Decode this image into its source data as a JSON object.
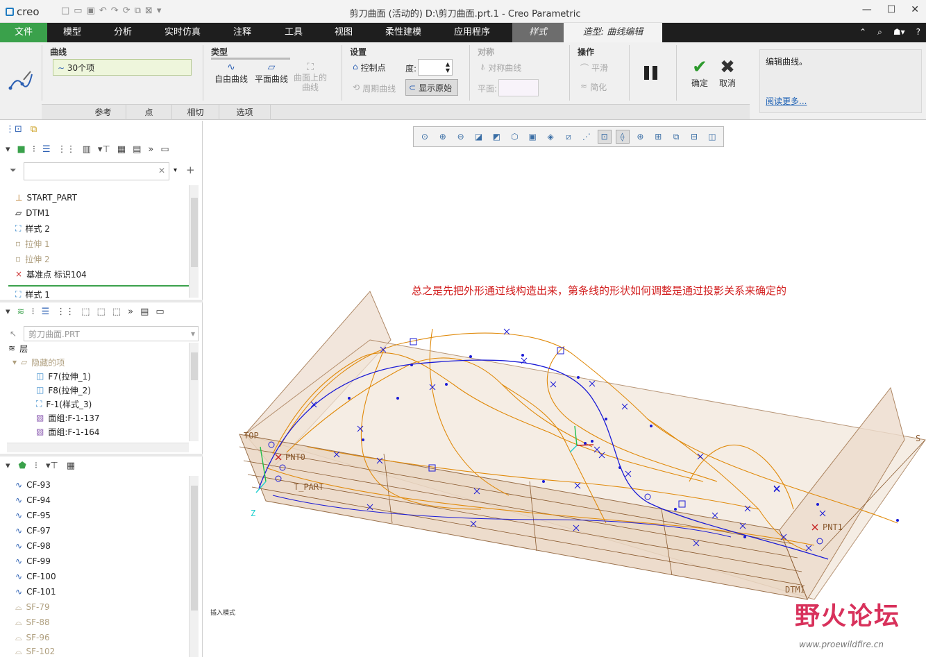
{
  "titlebar": {
    "logo": "creo",
    "title": "剪刀曲面 (活动的) D:\\剪刀曲面.prt.1 - Creo Parametric"
  },
  "menu": {
    "tabs": [
      "文件",
      "模型",
      "分析",
      "实时仿真",
      "注释",
      "工具",
      "视图",
      "柔性建模",
      "应用程序",
      "样式",
      "造型: 曲线编辑"
    ]
  },
  "ribbon": {
    "curve_group": "曲线",
    "curve_count": "30个项",
    "type_group": "类型",
    "type_free": "自由曲线",
    "type_plane": "平面曲线",
    "type_on_surface": "曲面上的曲线",
    "settings_group": "设置",
    "control_points": "控制点",
    "degree_label": "度:",
    "periodic": "周期曲线",
    "show_original": "显示原始",
    "symmetry_group": "对称",
    "symmetric_curve": "对称曲线",
    "plane_label": "平面:",
    "ops_group": "操作",
    "smooth": "平滑",
    "simplify": "简化",
    "ok": "确定",
    "cancel": "取消",
    "help_text": "编辑曲线。",
    "help_more": "阅读更多...",
    "subtabs": [
      "参考",
      "点",
      "相切",
      "选项"
    ]
  },
  "model_tree": {
    "items": [
      {
        "label": "START_PART",
        "state": "normal"
      },
      {
        "label": "DTM1",
        "state": "normal"
      },
      {
        "label": "样式 2",
        "state": "normal"
      },
      {
        "label": "拉伸 1",
        "state": "dim"
      },
      {
        "label": "拉伸 2",
        "state": "dim"
      },
      {
        "label": "基准点 标识104",
        "state": "normal"
      },
      {
        "label": "样式 1",
        "state": "normal"
      }
    ]
  },
  "layer_tree": {
    "part": "剪刀曲面.PRT",
    "root": "层",
    "hidden": "隐藏的项",
    "items": [
      "F7(拉伸_1)",
      "F8(拉伸_2)",
      "F-1(样式_3)",
      "面组:F-1-137",
      "面组:F-1-164"
    ]
  },
  "style_tree": {
    "curves": [
      "CF-93",
      "CF-94",
      "CF-95",
      "CF-97",
      "CF-98",
      "CF-99",
      "CF-100",
      "CF-101"
    ],
    "surfaces": [
      "SF-79",
      "SF-88",
      "SF-96",
      "SF-102"
    ]
  },
  "viewport": {
    "annotation": "总之是先把外形通过线构造出来，第条线的形状如何调整是通过投影关系来确定的",
    "labels": {
      "top": "TOP",
      "pnt0": "PNT0",
      "pnt1": "PNT1",
      "start": "T_PART",
      "dtm": "DTM1",
      "s": "S",
      "z": "Z"
    },
    "status": "插入模式"
  },
  "watermark": {
    "text": "野火论坛",
    "url": "www.proewildfire.cn"
  },
  "colors": {
    "file_tab": "#3aa14b",
    "curve": "#e08a0b",
    "spline": "#1b1bd6",
    "annotation": "#d21e1e",
    "plane": "#f2e6da"
  }
}
